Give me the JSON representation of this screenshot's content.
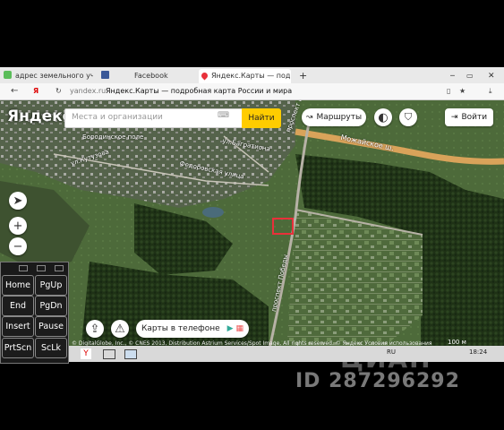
{
  "tabs": [
    {
      "label": "адрес земельного участка",
      "active": false
    },
    {
      "label": "Facebook",
      "active": false
    },
    {
      "label": "Яндекс.Карты — подробная",
      "active": true
    }
  ],
  "address_bar": {
    "domain": "yandex.ru",
    "page_title": "Яндекс.Карты — подробная карта России и мира"
  },
  "map": {
    "logo": "Яндекс",
    "search_placeholder": "Места и организации",
    "find_button": "Найти",
    "routes_button": "Маршруты",
    "login_button": "Войти",
    "phone_button": "Карты в телефоне",
    "labels": {
      "borodinskoe": "Бородинское поле",
      "kutuzova": "ул.Кутузова",
      "bagrationa": "ул.Багратиона",
      "fedoruskaya": "Федоровская улица",
      "mozhayskoe": "Можайское ш.",
      "pobedy": "проспект Победы",
      "pobedy2": "проспект Победы"
    },
    "copyright": "© DigitalGlobe, Inc., © CNES 2013, Distribution Astrium Services/Spot Image, All rights reserved. © Яндекс Условия использования",
    "scale": "100 м"
  },
  "keyboard": {
    "keys": [
      "Home",
      "PgUp",
      "End",
      "PgDn",
      "Insert",
      "Pause",
      "PrtScn",
      "ScLk"
    ]
  },
  "taskbar": {
    "lang": "RU",
    "time": "18:24"
  },
  "watermark": {
    "brand": "ЦИАН",
    "id": "ID 287296292"
  },
  "colors": {
    "find_button": "#ffcc00",
    "marker": "#e8303a",
    "road": "#d9a35a"
  }
}
